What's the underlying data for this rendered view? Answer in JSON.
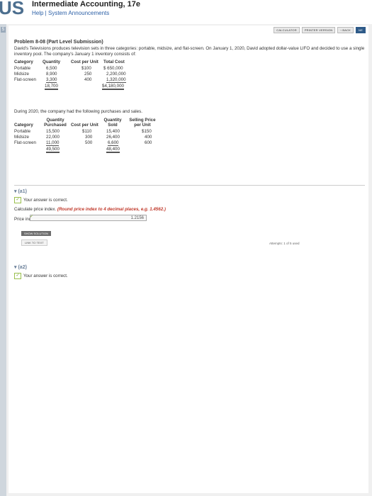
{
  "header": {
    "logo_text": "US",
    "course_title": "Intermediate Accounting, 17e",
    "links": "Help | System Announcements"
  },
  "toolbar": {
    "calculator": "CALCULATOR",
    "printer": "PRINTER VERSION",
    "back": "‹ BACK",
    "next": "NE"
  },
  "problem": {
    "title": "Problem 8-08 (Part Level Submission)",
    "intro": "David's Televisions produces television sets in three categories: portable, midsize, and flat-screen. On January 1, 2020, David adopted dollar-value LIFO and decided to use a single inventory pool. The company's January 1 inventory consists of:"
  },
  "inventory_table": {
    "headers": [
      "Category",
      "Quantity",
      "Cost per Unit",
      "Total Cost"
    ],
    "rows": [
      [
        "Portable",
        "6,500",
        "$100",
        "$ 650,000"
      ],
      [
        "Midsize",
        "8,900",
        "250",
        "2,200,000"
      ],
      [
        "Flat-screen",
        "3,300",
        "400",
        "1,320,000"
      ]
    ],
    "totals": [
      "",
      "18,700",
      "",
      "$4,180,000"
    ]
  },
  "during_text": "During 2020, the company had the following purchases and sales.",
  "purchases_table": {
    "headers": [
      "Category",
      "Quantity Purchased",
      "Cost per Unit",
      "Quantity Sold",
      "Selling Price per Unit"
    ],
    "rows": [
      [
        "Portable",
        "15,500",
        "$110",
        "15,400",
        "$150"
      ],
      [
        "Midsize",
        "22,000",
        "300",
        "26,400",
        "400"
      ],
      [
        "Flat-screen",
        "11,000",
        "500",
        "6,600",
        "600"
      ]
    ],
    "totals": [
      "",
      "49,500",
      "",
      "48,400",
      ""
    ]
  },
  "part_a1": {
    "label": "(a1)",
    "correct": "Your answer is correct.",
    "instruction_plain": "Calculate price index.",
    "instruction_emph": "(Round price index to 4 decimal places, e.g. 1.4562.)",
    "price_label": "Price index",
    "price_value": "1.2156",
    "solution_button": "SHOW SOLUTION",
    "text_link": "LINK TO TEXT",
    "attempts": "Attempts: 1 of 5 used"
  },
  "part_a2": {
    "label": "(a2)",
    "correct": "Your answer is correct."
  },
  "sidebar": {
    "badge": "5"
  }
}
